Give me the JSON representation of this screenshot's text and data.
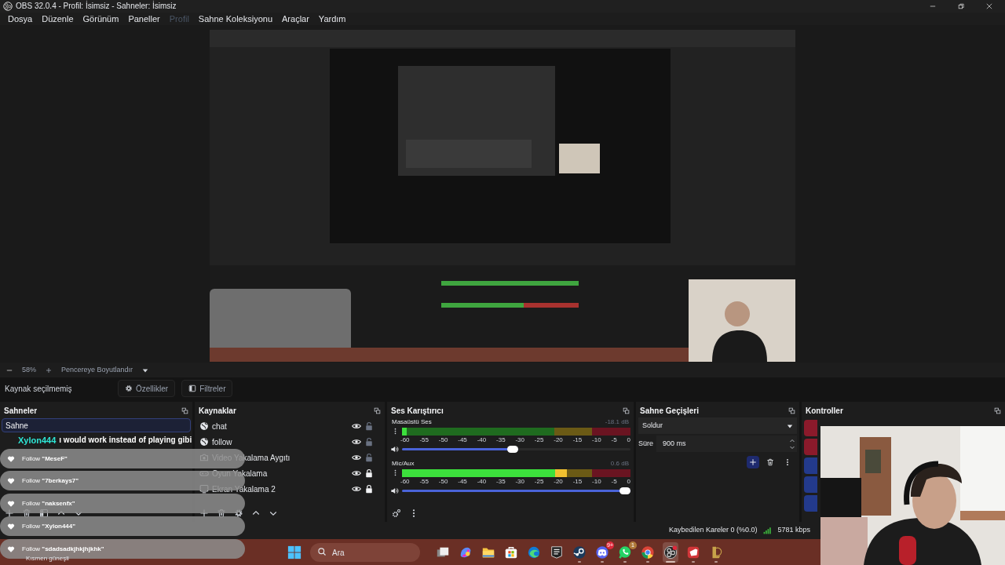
{
  "window": {
    "title": "OBS 32.0.4 - Profil: İsimsiz - Sahneler: İsimsiz"
  },
  "menu": [
    {
      "label": "Dosya",
      "disabled": false
    },
    {
      "label": "Düzenle",
      "disabled": false
    },
    {
      "label": "Görünüm",
      "disabled": false
    },
    {
      "label": "Paneller",
      "disabled": false
    },
    {
      "label": "Profil",
      "disabled": true
    },
    {
      "label": "Sahne Koleksiyonu",
      "disabled": false
    },
    {
      "label": "Araçlar",
      "disabled": false
    },
    {
      "label": "Yardım",
      "disabled": false
    }
  ],
  "preview_bar": {
    "zoom": "58%",
    "fit": "Pencereye Boyutlandır"
  },
  "context_bar": {
    "status": "Kaynak seçilmemiş",
    "buttons": [
      {
        "kind": "properties",
        "label": "Özellikler"
      },
      {
        "kind": "filters",
        "label": "Filtreler"
      }
    ]
  },
  "scenes": {
    "title": "Sahneler",
    "items": [
      {
        "name": "Sahne",
        "selected": true
      }
    ]
  },
  "sources": {
    "title": "Kaynaklar",
    "items": [
      {
        "name": "chat",
        "kind": "browser",
        "visible": true,
        "locked": false
      },
      {
        "name": "follow",
        "kind": "browser",
        "visible": true,
        "locked": false
      },
      {
        "name": "Video Yakalama Aygıtı",
        "kind": "camera",
        "visible": true,
        "locked": false
      },
      {
        "name": "Oyun Yakalama",
        "kind": "game",
        "visible": true,
        "locked": true
      },
      {
        "name": "Ekran Yakalama 2",
        "kind": "display",
        "visible": true,
        "locked": true
      }
    ]
  },
  "mixer": {
    "title": "Ses Karıştırıcı",
    "channels": [
      {
        "name": "Masaüstü Ses",
        "reading": "-18.1 dB",
        "meter": {
          "level": 0.02
        },
        "volume": {
          "level": 0.51
        },
        "scale": [
          "-60",
          "-55",
          "-50",
          "-45",
          "-40",
          "-35",
          "-30",
          "-25",
          "-20",
          "-15",
          "-10",
          "-5",
          "0"
        ]
      },
      {
        "name": "Mic/Aux",
        "reading": "0.6 dB",
        "meter": {
          "level": 0.72
        },
        "volume": {
          "level": 1
        },
        "scale": [
          "-60",
          "-55",
          "-50",
          "-45",
          "-40",
          "-35",
          "-30",
          "-25",
          "-20",
          "-15",
          "-10",
          "-5",
          "0"
        ]
      }
    ]
  },
  "transitions": {
    "title": "Sahne Geçişleri",
    "transition": "Soldur",
    "duration_label": "Süre",
    "duration": "900 ms"
  },
  "controls": {
    "title": "Kontroller",
    "buttons": [
      {
        "color": "#8b1a2b"
      },
      {
        "color": "#8b1a2b"
      },
      {
        "color": "#233a8c"
      },
      {
        "color": "#233a8c"
      },
      {
        "color": "#233a8c"
      }
    ]
  },
  "status_bar": {
    "dropped_frames": "Kaybedilen Kareler 0 (%0.0)",
    "bitrate": "5781 kbps"
  },
  "overlay": {
    "chat": {
      "user": "Xylon444",
      "message": "ı would work instead of playing gibi"
    },
    "alerts": [
      "Follow **\"MeseF\"**",
      "Follow **\"7berkays7\"**",
      "Follow **\"naksenfx\"**",
      "Follow **\"Xylon444\"**",
      "Follow **\"sdadsadkjhkjhjkhk\"**"
    ]
  },
  "taskbar": {
    "search": {
      "placeholder": "Ara"
    },
    "weather": "Kısmen güneşli",
    "apps": [
      {
        "kind": "taskview",
        "running": false,
        "active": false
      },
      {
        "kind": "copilot",
        "running": false,
        "active": false
      },
      {
        "kind": "explorer",
        "running": false,
        "active": false
      },
      {
        "kind": "store",
        "running": false,
        "active": false
      },
      {
        "kind": "edge",
        "running": false,
        "active": false
      },
      {
        "kind": "epic",
        "running": false,
        "active": false
      },
      {
        "kind": "steam",
        "running": true,
        "active": false
      },
      {
        "kind": "discord",
        "running": true,
        "active": false,
        "badge": "9+"
      },
      {
        "kind": "whatsapp",
        "running": true,
        "active": false,
        "badge": "1"
      },
      {
        "kind": "chrome",
        "running": true,
        "active": false
      },
      {
        "kind": "obs",
        "running": true,
        "active": true
      },
      {
        "kind": "riot",
        "running": true,
        "active": false
      },
      {
        "kind": "league",
        "running": true,
        "active": false
      }
    ]
  }
}
